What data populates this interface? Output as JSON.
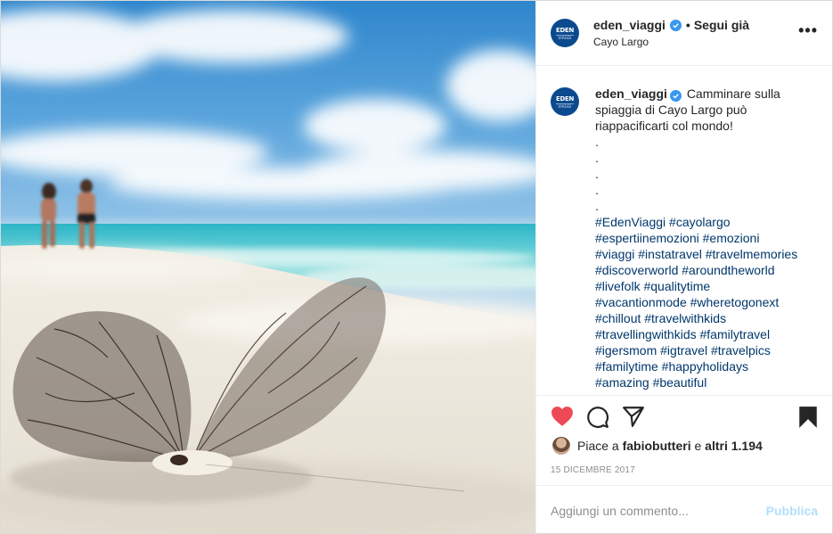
{
  "post": {
    "username": "eden_viaggi",
    "follow_status": "Segui già",
    "separator": "•",
    "location": "Cayo Largo",
    "more_label": "•••",
    "avatar": {
      "line1": "EDEN",
      "line2": "VIAGGI"
    }
  },
  "caption": {
    "username": "eden_viaggi",
    "text": "Camminare sulla spiaggia di Cayo Largo può riappacificarti col mondo!",
    "dots": [
      ".",
      ".",
      ".",
      ".",
      "."
    ],
    "hashtag_lines": [
      "#EdenViaggi #cayolargo",
      "#espertiinemozioni #emozioni",
      "#viaggi #instatravel #travelmemories",
      "#discoverworld #aroundtheworld",
      "#livefolk #qualitytime",
      "#vacantionmode #wheretogonext",
      "#chillout #travelwithkids",
      "#travellingwithkids #familytravel",
      "#igersmom #igtravel #travelpics",
      "#familytime #happyholidays",
      "#amazing #beautiful"
    ]
  },
  "actions": {
    "like_icon": "heart-icon",
    "comment_icon": "comment-icon",
    "share_icon": "share-icon",
    "save_icon": "bookmark-icon",
    "liked": true,
    "like_color": "#ed4956"
  },
  "likes": {
    "prefix": "Piace a",
    "user": "fabiobutteri",
    "conjunction": "e",
    "others": "altri 1.194"
  },
  "date": "15 DICEMBRE 2017",
  "comment_box": {
    "placeholder": "Aggiungi un commento...",
    "publish_label": "Pubblica"
  },
  "colors": {
    "link": "#00376b",
    "verified": "#3897f0",
    "publish_disabled": "#b2dffc",
    "avatar_bg": "#0b4a8f"
  }
}
